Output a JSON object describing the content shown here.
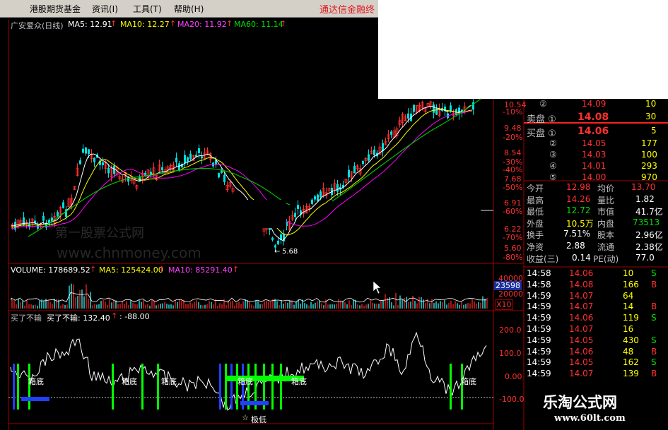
{
  "menubar": {
    "items": [
      "港股期货基金",
      "资讯(I)",
      "工具(T)",
      "帮助(H)"
    ],
    "brand": "通达信金融终"
  },
  "price_chart": {
    "header": {
      "stock": "广安爱众(日线)",
      "ma5": "MA5: 12.91",
      "ma10": "MA10: 12.27",
      "ma20": "MA20: 11.92",
      "ma60": "MA60: 11.14"
    },
    "axis_prices": [
      "10.54",
      "9.48",
      "8.54",
      "7.68",
      "6.91",
      "6.22",
      "5.60"
    ],
    "axis_pcts": [
      "-10%",
      "-20%",
      "-30%",
      "-40%",
      "-50%",
      "-60%",
      "-70%",
      "-80%"
    ],
    "low_marker": "5.68",
    "watermark_cn": "第一股票公式网",
    "watermark_en": "www.chnmoney.com"
  },
  "volume_chart": {
    "header": {
      "volume": "VOLUME: 178689.52",
      "ma5": "MA5: 125424.00",
      "ma10": "MA10: 85291.40"
    },
    "axis_labels": [
      "40000",
      "23598",
      "20000",
      "X10"
    ]
  },
  "indicator_chart": {
    "header": {
      "name": "买了不输",
      "value": "买了不输: 132.40",
      "extra": ": -88.00"
    },
    "axis_labels": [
      "200.0",
      "100.0",
      "0.00",
      "-100.0"
    ],
    "labels": [
      "箱底",
      "箱底",
      "箱底",
      "箱底",
      "箱底",
      "箱底"
    ],
    "star_label": "极低"
  },
  "order_book": {
    "asks": [
      {
        "label": "②",
        "price": "14.09",
        "vol": "10"
      },
      {
        "label": "卖盘 ①",
        "price": "14.08",
        "vol": "30"
      }
    ],
    "bids": [
      {
        "label": "买盘 ①",
        "price": "14.06",
        "vol": "5"
      },
      {
        "label": "②",
        "price": "14.05",
        "vol": "177"
      },
      {
        "label": "③",
        "price": "14.03",
        "vol": "100"
      },
      {
        "label": "④",
        "price": "14.01",
        "vol": "293"
      },
      {
        "label": "⑤",
        "price": "14.00",
        "vol": "970"
      }
    ]
  },
  "stats": [
    {
      "l1": "今开",
      "v1": "12.98",
      "l2": "均价",
      "v2": "13.70"
    },
    {
      "l1": "最高",
      "v1": "14.26",
      "l2": "量比",
      "v2": "1.82"
    },
    {
      "l1": "最低",
      "v1": "12.72",
      "l2": "市值",
      "v2": "41.7亿"
    },
    {
      "l1": "外盘",
      "v1": "10.5万",
      "l2": "内盘",
      "v2": "73513"
    },
    {
      "l1": "换手",
      "v1": "7.51%",
      "l2": "股本",
      "v2": "2.96亿"
    },
    {
      "l1": "净资",
      "v1": "2.88",
      "l2": "流通",
      "v2": "2.38亿"
    },
    {
      "l1": "收益(三)",
      "v1": "0.14",
      "l2": "PE(动)",
      "v2": "77.0"
    }
  ],
  "ticks": [
    {
      "time": "14:58",
      "price": "14.06",
      "vol": "10",
      "side": "S"
    },
    {
      "time": "14:58",
      "price": "14.08",
      "vol": "166",
      "side": "B"
    },
    {
      "time": "14:59",
      "price": "14.07",
      "vol": "64",
      "side": ""
    },
    {
      "time": "14:59",
      "price": "14.07",
      "vol": "14",
      "side": "B"
    },
    {
      "time": "14:59",
      "price": "14.06",
      "vol": "119",
      "side": "S"
    },
    {
      "time": "14:59",
      "price": "14.07",
      "vol": "16",
      "side": ""
    },
    {
      "time": "14:59",
      "price": "14.05",
      "vol": "430",
      "side": "S"
    },
    {
      "time": "14:59",
      "price": "14.06",
      "vol": "48",
      "side": "B"
    },
    {
      "time": "14:59",
      "price": "14.05",
      "vol": "162",
      "side": "S"
    },
    {
      "time": "14:59",
      "price": "14.07",
      "vol": "139",
      "side": "B"
    }
  ],
  "ad": {
    "title": "乐淘公式网",
    "url": "www.60lt.com"
  },
  "colors": {
    "up": "#ff3030",
    "down": "#00e0e0",
    "ma5": "#ffffff",
    "ma10": "#ffff00",
    "ma20": "#ff00ff",
    "ma60": "#00c000",
    "signal": "#00ff00",
    "signal2": "#2040ff"
  }
}
